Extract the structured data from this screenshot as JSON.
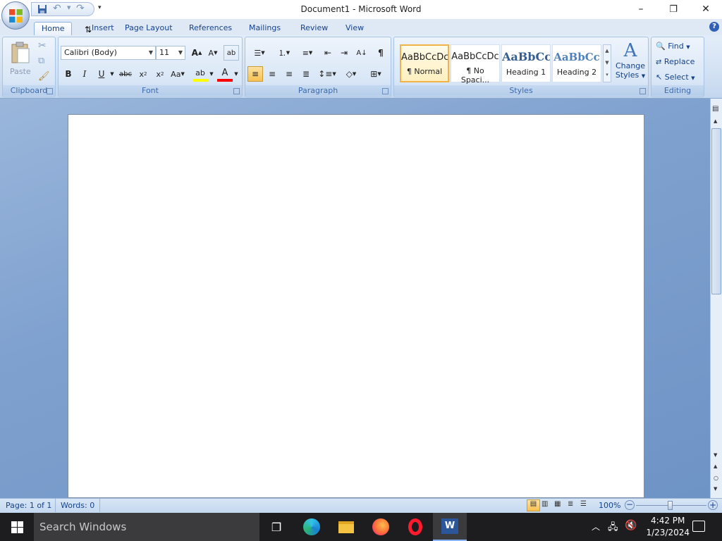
{
  "window": {
    "title": "Document1 - Microsoft Word",
    "minimize": "–",
    "maximize": "❐",
    "close": "✕"
  },
  "tabs": [
    "Home",
    "Insert",
    "Page Layout",
    "References",
    "Mailings",
    "Review",
    "View"
  ],
  "ribbon": {
    "clipboard": {
      "label": "Clipboard",
      "paste": "Paste"
    },
    "font": {
      "label": "Font",
      "family": "Calibri (Body)",
      "size": "11"
    },
    "paragraph": {
      "label": "Paragraph"
    },
    "styles": {
      "label": "Styles",
      "items": [
        {
          "sample": "AaBbCcDc",
          "name": "¶ Normal"
        },
        {
          "sample": "AaBbCcDc",
          "name": "¶ No Spaci..."
        },
        {
          "sample": "AaBbCc",
          "name": "Heading 1"
        },
        {
          "sample": "AaBbCc",
          "name": "Heading 2"
        }
      ],
      "change_styles_1": "Change",
      "change_styles_2": "Styles"
    },
    "editing": {
      "label": "Editing",
      "find": "Find",
      "replace": "Replace",
      "select": "Select"
    }
  },
  "status": {
    "page": "Page: 1 of 1",
    "words": "Words: 0",
    "zoom": "100%"
  },
  "taskbar": {
    "search_placeholder": "Search Windows",
    "time": "4:42 PM",
    "date": "1/23/2024"
  },
  "colors": {
    "ribbon_blue": "#15428b",
    "highlight": "#ffff00",
    "font_color": "#ff0000",
    "taskbar": "#1d1d1f"
  }
}
